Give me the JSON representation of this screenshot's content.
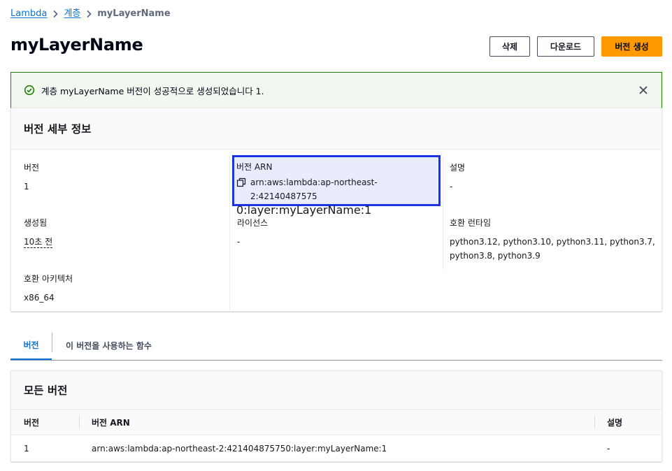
{
  "breadcrumb": {
    "items": [
      "Lambda",
      "계층"
    ],
    "current": "myLayerName"
  },
  "header": {
    "title": "myLayerName",
    "buttons": {
      "delete": "삭제",
      "download": "다운로드",
      "create_version": "버전 생성"
    }
  },
  "flash": {
    "message": "계층 myLayerName 버전이 성공적으로 생성되었습니다 1.",
    "type": "success"
  },
  "details": {
    "title": "버전 세부 정보",
    "version": {
      "label": "버전",
      "value": "1"
    },
    "arn": {
      "label": "버전 ARN",
      "line1": "arn:aws:lambda:ap-northeast-2:42140487575",
      "line2": "0:layer:myLayerName:1"
    },
    "description": {
      "label": "설명",
      "value": "-"
    },
    "created": {
      "label": "생성됨",
      "value": "10초 전"
    },
    "license": {
      "label": "라이선스",
      "value": "-"
    },
    "runtimes": {
      "label": "호환 런타임",
      "line1": "python3.12, python3.10, python3.11, python3.7,",
      "line2": "python3.8, python3.9"
    },
    "architectures": {
      "label": "호환 아키텍처",
      "value": "x86_64"
    }
  },
  "tabs": [
    {
      "label": "버전",
      "active": true
    },
    {
      "label": "이 버전을 사용하는 함수",
      "active": false
    }
  ],
  "versions_table": {
    "title": "모든 버전",
    "columns": [
      "버전",
      "버전 ARN",
      "설명"
    ],
    "rows": [
      [
        "1",
        "arn:aws:lambda:ap-northeast-2:421404875750:layer:myLayerName:1",
        "-"
      ]
    ]
  },
  "colors": {
    "link": "#0972d3",
    "primary_button": "#ff9900",
    "success": "#1d8102",
    "highlight_border": "#1a35e0"
  }
}
